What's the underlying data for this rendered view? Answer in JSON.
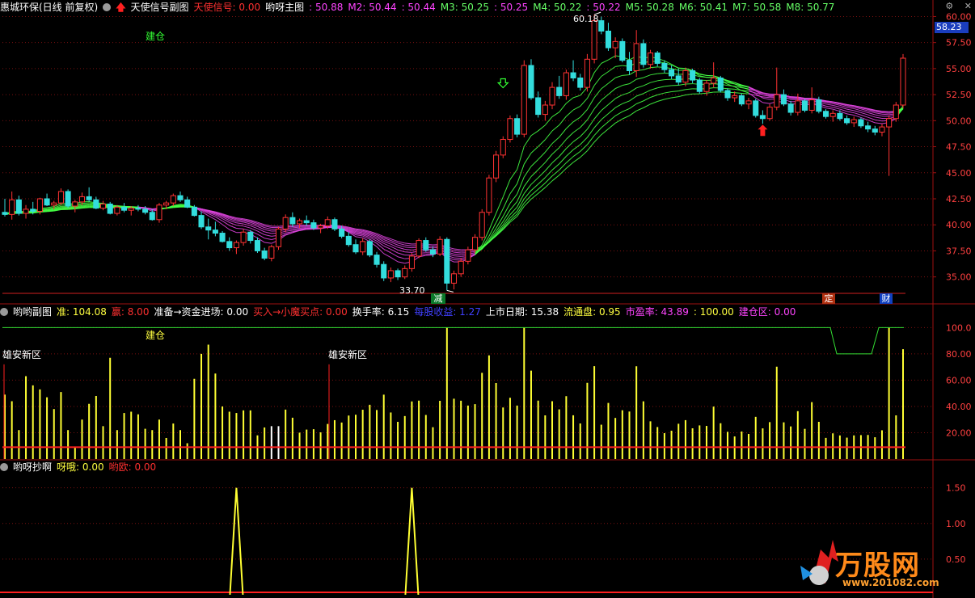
{
  "header_main": {
    "stock": "惠城环保(日线 前复权)",
    "indicator": "天使信号副图",
    "signal_label": "天使信号: 0.00",
    "main_label": "哟呀主图",
    "mas": [
      {
        "label": ": 50.88",
        "color": "#ff44ff"
      },
      {
        "label": "M2: 50.44",
        "color": "#ff44ff"
      },
      {
        "label": ": 50.44",
        "color": "#ff44ff"
      },
      {
        "label": "M3: 50.25",
        "color": "#66ff66"
      },
      {
        "label": ": 50.25",
        "color": "#ff44ff"
      },
      {
        "label": "M4: 50.22",
        "color": "#66ff66"
      },
      {
        "label": ": 50.22",
        "color": "#ff44ff"
      },
      {
        "label": "M5: 50.28",
        "color": "#66ff66"
      },
      {
        "label": "M6: 50.41",
        "color": "#66ff66"
      },
      {
        "label": "M7: 50.58",
        "color": "#66ff66"
      },
      {
        "label": "M8: 50.77",
        "color": "#66ff66"
      }
    ]
  },
  "header_sub1": {
    "title": "哟哟副图",
    "items": [
      {
        "label": "准: 104.08",
        "color": "#ffff40"
      },
      {
        "label": "赢: 8.00",
        "color": "#ff3030"
      },
      {
        "label": "准备→资金进场: 0.00",
        "color": "#ffffff"
      },
      {
        "label": "买入→小魔买点: 0.00",
        "color": "#ff3030"
      },
      {
        "label": "换手率: 6.15",
        "color": "#ffffff"
      },
      {
        "label": "每股收益: 1.27",
        "color": "#4040ff"
      },
      {
        "label": "上市日期: 15.38",
        "color": "#ffffff"
      },
      {
        "label": "流通盘: 0.95",
        "color": "#ffff40"
      },
      {
        "label": "市盈率: 43.89",
        "color": "#ff44ff"
      },
      {
        "label": ": 100.00",
        "color": "#ffff40"
      },
      {
        "label": "建仓区: 0.00",
        "color": "#ff44ff"
      }
    ]
  },
  "header_sub2": {
    "title": "哟呀抄啊",
    "items": [
      {
        "label": "呀哦: 0.00",
        "color": "#ffff40"
      },
      {
        "label": "哟欧: 0.00",
        "color": "#ff3030"
      }
    ]
  },
  "current_price": "58.23",
  "labels": {
    "jiancang_main": "建仓",
    "jiancang_sub": "建仓",
    "xiongan1": "雄安新区",
    "xiongan2": "雄安新区",
    "high_mark": "60.18",
    "low_mark": "33.70",
    "jian": "减",
    "ding": "定",
    "cai": "财"
  },
  "watermark": {
    "text": "万股网",
    "url": "www.201082.com"
  },
  "logo": {
    "text": "万股网",
    "url": "www.201082.com"
  },
  "chart_data": [
    {
      "type": "candlestick",
      "panel": "main",
      "ylim": [
        33.5,
        60.5
      ],
      "yticks": [
        "60.00",
        "57.50",
        "55.00",
        "52.50",
        "50.00",
        "47.50",
        "45.00",
        "42.50",
        "40.00",
        "37.50",
        "35.00"
      ],
      "ohlc": [
        [
          41.2,
          42.5,
          40.8,
          41.0
        ],
        [
          41.0,
          43.2,
          40.5,
          42.4
        ],
        [
          42.4,
          42.8,
          40.9,
          41.1
        ],
        [
          41.1,
          41.9,
          40.6,
          41.5
        ],
        [
          41.5,
          42.2,
          41.0,
          41.3
        ],
        [
          41.3,
          42.6,
          41.0,
          42.5
        ],
        [
          42.5,
          43.0,
          41.8,
          41.9
        ],
        [
          41.9,
          42.3,
          41.5,
          42.1
        ],
        [
          42.1,
          43.5,
          41.9,
          43.2
        ],
        [
          43.2,
          43.4,
          41.6,
          41.8
        ],
        [
          41.8,
          42.4,
          41.2,
          42.2
        ],
        [
          42.2,
          43.1,
          41.9,
          42.7
        ],
        [
          42.7,
          43.6,
          42.2,
          42.4
        ],
        [
          42.4,
          42.7,
          41.5,
          41.6
        ],
        [
          41.6,
          42.3,
          41.4,
          42.0
        ],
        [
          42.0,
          42.2,
          41.0,
          41.1
        ],
        [
          41.1,
          41.9,
          40.9,
          41.7
        ],
        [
          41.7,
          42.1,
          41.2,
          41.4
        ],
        [
          41.4,
          41.8,
          40.9,
          41.6
        ],
        [
          41.6,
          41.9,
          41.3,
          41.5
        ],
        [
          41.5,
          41.8,
          41.0,
          41.2
        ],
        [
          41.2,
          41.5,
          40.4,
          40.5
        ],
        [
          40.5,
          42.1,
          40.2,
          41.9
        ],
        [
          41.9,
          42.3,
          41.5,
          42.1
        ],
        [
          42.1,
          43.0,
          41.8,
          42.8
        ],
        [
          42.8,
          43.2,
          42.2,
          42.4
        ],
        [
          42.4,
          42.7,
          41.6,
          41.7
        ],
        [
          41.7,
          41.9,
          40.8,
          40.9
        ],
        [
          40.9,
          41.3,
          39.6,
          39.8
        ],
        [
          39.8,
          40.6,
          38.6,
          39.5
        ],
        [
          39.5,
          40.3,
          38.9,
          39.2
        ],
        [
          39.2,
          39.4,
          38.3,
          38.4
        ],
        [
          38.4,
          38.8,
          37.5,
          37.8
        ],
        [
          37.8,
          38.5,
          37.2,
          38.3
        ],
        [
          38.3,
          39.6,
          38.0,
          39.3
        ],
        [
          39.3,
          39.5,
          38.2,
          38.5
        ],
        [
          38.5,
          38.8,
          37.3,
          37.5
        ],
        [
          37.5,
          37.8,
          36.6,
          36.8
        ],
        [
          36.8,
          38.1,
          36.5,
          37.9
        ],
        [
          37.9,
          39.8,
          37.6,
          39.6
        ],
        [
          39.6,
          41.0,
          39.3,
          40.7
        ],
        [
          40.7,
          41.2,
          39.8,
          40.1
        ],
        [
          40.1,
          40.6,
          39.7,
          40.4
        ],
        [
          40.4,
          40.9,
          39.9,
          40.2
        ],
        [
          40.2,
          40.5,
          39.5,
          39.7
        ],
        [
          39.7,
          40.1,
          39.2,
          39.9
        ],
        [
          39.9,
          40.8,
          39.6,
          40.5
        ],
        [
          40.5,
          40.7,
          39.4,
          39.6
        ],
        [
          39.6,
          39.9,
          38.7,
          38.9
        ],
        [
          38.9,
          39.3,
          37.9,
          38.1
        ],
        [
          38.1,
          38.6,
          37.2,
          37.4
        ],
        [
          37.4,
          38.7,
          37.1,
          38.4
        ],
        [
          38.4,
          38.6,
          36.9,
          37.1
        ],
        [
          37.1,
          37.4,
          35.9,
          36.2
        ],
        [
          36.2,
          36.5,
          34.6,
          34.9
        ],
        [
          34.9,
          35.9,
          34.5,
          35.6
        ],
        [
          35.6,
          35.8,
          34.7,
          35.0
        ],
        [
          35.0,
          36.1,
          34.8,
          35.8
        ],
        [
          35.8,
          37.3,
          35.5,
          37.0
        ],
        [
          37.0,
          38.7,
          36.8,
          38.5
        ],
        [
          38.5,
          38.8,
          37.4,
          37.6
        ],
        [
          37.6,
          37.9,
          36.9,
          37.2
        ],
        [
          37.2,
          38.9,
          37.0,
          38.6
        ],
        [
          38.6,
          38.8,
          33.7,
          34.4
        ],
        [
          34.4,
          35.6,
          33.8,
          35.3
        ],
        [
          35.3,
          36.8,
          35.0,
          36.5
        ],
        [
          36.5,
          37.9,
          36.2,
          37.6
        ],
        [
          37.6,
          39.1,
          37.3,
          38.8
        ],
        [
          38.8,
          41.5,
          38.5,
          41.2
        ],
        [
          41.2,
          44.8,
          40.9,
          44.5
        ],
        [
          44.5,
          47.1,
          44.1,
          46.7
        ],
        [
          46.7,
          48.5,
          46.4,
          48.2
        ],
        [
          48.2,
          50.5,
          47.9,
          50.2
        ],
        [
          50.2,
          50.6,
          48.4,
          48.7
        ],
        [
          48.7,
          55.8,
          48.4,
          55.3
        ],
        [
          55.3,
          55.9,
          52.0,
          52.2
        ],
        [
          52.2,
          52.8,
          50.3,
          50.6
        ],
        [
          50.6,
          51.9,
          50.0,
          51.5
        ],
        [
          51.5,
          53.7,
          51.1,
          53.2
        ],
        [
          53.2,
          54.3,
          52.1,
          52.4
        ],
        [
          52.4,
          54.9,
          52.0,
          54.6
        ],
        [
          54.6,
          55.8,
          53.8,
          54.1
        ],
        [
          54.1,
          54.5,
          52.9,
          53.2
        ],
        [
          53.2,
          56.4,
          52.8,
          55.9
        ],
        [
          55.9,
          60.18,
          55.5,
          59.6
        ],
        [
          59.6,
          60.0,
          58.3,
          58.6
        ],
        [
          58.6,
          59.4,
          56.7,
          57.0
        ],
        [
          57.0,
          58.0,
          56.0,
          57.6
        ],
        [
          57.6,
          57.9,
          55.6,
          55.8
        ],
        [
          55.8,
          56.6,
          54.4,
          54.8
        ],
        [
          54.8,
          58.7,
          54.2,
          57.4
        ],
        [
          57.4,
          57.8,
          55.1,
          55.4
        ],
        [
          55.4,
          56.8,
          55.0,
          56.5
        ],
        [
          56.5,
          56.7,
          55.2,
          55.5
        ],
        [
          55.5,
          55.8,
          54.6,
          54.9
        ],
        [
          54.9,
          55.3,
          54.0,
          54.3
        ],
        [
          54.3,
          55.0,
          53.4,
          53.7
        ],
        [
          53.7,
          55.1,
          53.3,
          54.8
        ],
        [
          54.8,
          55.0,
          53.6,
          53.9
        ],
        [
          53.9,
          54.1,
          52.6,
          52.8
        ],
        [
          52.8,
          53.9,
          52.4,
          53.6
        ],
        [
          53.6,
          55.6,
          53.2,
          54.1
        ],
        [
          54.1,
          54.3,
          52.7,
          52.9
        ],
        [
          52.9,
          53.1,
          51.9,
          52.2
        ],
        [
          52.2,
          52.8,
          51.8,
          52.4
        ],
        [
          52.4,
          52.6,
          51.4,
          51.6
        ],
        [
          51.6,
          52.2,
          51.1,
          51.9
        ],
        [
          51.9,
          52.1,
          50.3,
          50.5
        ],
        [
          50.5,
          51.0,
          49.7,
          50.2
        ],
        [
          50.2,
          51.6,
          50.0,
          51.3
        ],
        [
          51.3,
          55.1,
          51.0,
          52.5
        ],
        [
          52.5,
          53.0,
          51.4,
          51.6
        ],
        [
          51.6,
          51.9,
          50.5,
          50.8
        ],
        [
          50.8,
          52.6,
          50.5,
          51.9
        ],
        [
          51.9,
          52.1,
          50.8,
          51.0
        ],
        [
          51.0,
          53.2,
          50.7,
          52.0
        ],
        [
          52.0,
          52.3,
          50.7,
          50.9
        ],
        [
          50.9,
          51.1,
          50.2,
          50.4
        ],
        [
          50.4,
          51.0,
          49.9,
          50.7
        ],
        [
          50.7,
          51.0,
          50.0,
          50.2
        ],
        [
          50.2,
          50.5,
          49.6,
          49.8
        ],
        [
          49.8,
          50.4,
          49.4,
          50.1
        ],
        [
          50.1,
          50.3,
          49.3,
          49.5
        ],
        [
          49.5,
          49.9,
          48.9,
          49.2
        ],
        [
          49.2,
          49.5,
          48.6,
          48.9
        ],
        [
          48.9,
          49.7,
          48.5,
          49.4
        ],
        [
          49.4,
          50.5,
          44.7,
          50.2
        ],
        [
          50.2,
          51.8,
          49.9,
          51.5
        ],
        [
          51.5,
          56.4,
          51.2,
          56.0
        ]
      ],
      "markers": [
        {
          "type": "down-arrow-outline",
          "index": 71,
          "price": 53.4,
          "color": "#33ff33"
        },
        {
          "type": "up-arrow",
          "index": 108,
          "price": 49.0,
          "color": "#ff2020"
        }
      ],
      "ribbon_ma": {
        "count": 8
      }
    },
    {
      "type": "bar",
      "panel": "sub1",
      "ylim": [
        0,
        107
      ],
      "yticks": [
        "100.0",
        "80.00",
        "60.00",
        "40.00",
        "20.00"
      ],
      "values": [
        49,
        44,
        22,
        63,
        56,
        53,
        47,
        38,
        51,
        22,
        9,
        30,
        42,
        48,
        25,
        77,
        22,
        35,
        36,
        34,
        23,
        22,
        30,
        16,
        27,
        22,
        12,
        61,
        80,
        87,
        65,
        40,
        36,
        35,
        37,
        37,
        18,
        24,
        25,
        25,
        0,
        0,
        0,
        0,
        0,
        0,
        0,
        0,
        0,
        0,
        0,
        0,
        0,
        0,
        0,
        0,
        0,
        0,
        0,
        0,
        0,
        0,
        0,
        0,
        0,
        0,
        0,
        0,
        0,
        0,
        0,
        0,
        0,
        0,
        0,
        0,
        0,
        0,
        0,
        0,
        0,
        0,
        0,
        0,
        0,
        0,
        0,
        0,
        0,
        0,
        0,
        0,
        0,
        0,
        0,
        0,
        0,
        0,
        0,
        0,
        0,
        0,
        0,
        0,
        0,
        0,
        0,
        0,
        0,
        0,
        0,
        0,
        0,
        0,
        0,
        0,
        0,
        0,
        0,
        0,
        0,
        0,
        0,
        0,
        0,
        0,
        0,
        0,
        0,
        0
      ],
      "series": [
        {
          "name": "",
          "values": []
        }
      ],
      "green_line": [
        100,
        100,
        100,
        80,
        80,
        100,
        100
      ]
    },
    {
      "type": "line",
      "panel": "sub2",
      "ylim": [
        0,
        1.7
      ],
      "yticks": [
        "1.50",
        "1.00",
        "0.50"
      ],
      "spikes": [
        {
          "index": 33,
          "value": 1.5
        },
        {
          "index": 58,
          "value": 1.5
        }
      ]
    }
  ]
}
